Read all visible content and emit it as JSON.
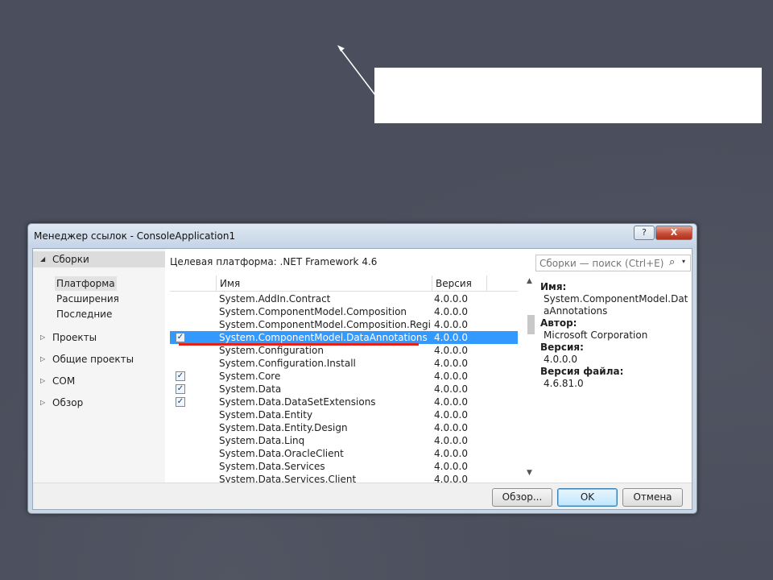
{
  "dialog": {
    "title": "Менеджер ссылок - ConsoleApplication1",
    "help_button": "?",
    "close_button": "X"
  },
  "nav": {
    "assemblies": "Сборки",
    "platform": "Платформа",
    "extensions": "Расширения",
    "recent": "Последние",
    "projects": "Проекты",
    "shared_projects": "Общие проекты",
    "com": "COM",
    "browse": "Обзор"
  },
  "target_platform": "Целевая платформа: .NET Framework 4.6",
  "search": {
    "placeholder": "Сборки — поиск (Ctrl+E)"
  },
  "columns": {
    "name": "Имя",
    "version": "Версия"
  },
  "rows": [
    {
      "name": "System.AddIn.Contract",
      "version": "4.0.0.0",
      "checked": false
    },
    {
      "name": "System.ComponentModel.Composition",
      "version": "4.0.0.0",
      "checked": false
    },
    {
      "name": "System.ComponentModel.Composition.Regist...",
      "version": "4.0.0.0",
      "checked": false
    },
    {
      "name": "System.ComponentModel.DataAnnotations",
      "version": "4.0.0.0",
      "checked": true,
      "selected": true
    },
    {
      "name": "System.Configuration",
      "version": "4.0.0.0",
      "checked": false
    },
    {
      "name": "System.Configuration.Install",
      "version": "4.0.0.0",
      "checked": false
    },
    {
      "name": "System.Core",
      "version": "4.0.0.0",
      "checked": true
    },
    {
      "name": "System.Data",
      "version": "4.0.0.0",
      "checked": true
    },
    {
      "name": "System.Data.DataSetExtensions",
      "version": "4.0.0.0",
      "checked": true
    },
    {
      "name": "System.Data.Entity",
      "version": "4.0.0.0",
      "checked": false
    },
    {
      "name": "System.Data.Entity.Design",
      "version": "4.0.0.0",
      "checked": false
    },
    {
      "name": "System.Data.Linq",
      "version": "4.0.0.0",
      "checked": false
    },
    {
      "name": "System.Data.OracleClient",
      "version": "4.0.0.0",
      "checked": false
    },
    {
      "name": "System.Data.Services",
      "version": "4.0.0.0",
      "checked": false
    },
    {
      "name": "System.Data.Services.Client",
      "version": "4.0.0.0",
      "checked": false
    }
  ],
  "details": {
    "name_label": "Имя:",
    "name_value": "System.ComponentModel.DataAnnotations",
    "author_label": "Автор:",
    "author_value": "Microsoft Corporation",
    "version_label": "Версия:",
    "version_value": "4.0.0.0",
    "file_version_label": "Версия файла:",
    "file_version_value": "4.6.81.0"
  },
  "buttons": {
    "browse": "Обзор...",
    "ok": "OK",
    "cancel": "Отмена"
  },
  "colors": {
    "selection": "#3399ff",
    "underline": "#e2231a",
    "slide_bg": "#4b4e5c"
  }
}
